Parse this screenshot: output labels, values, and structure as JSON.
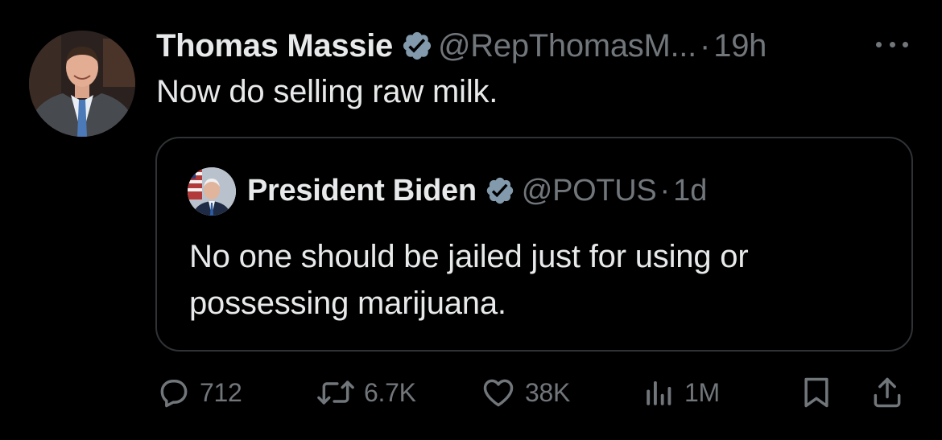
{
  "tweet": {
    "author_name": "Thomas Massie",
    "author_handle": "@RepThomasM...",
    "separator": "·",
    "time": "19h",
    "text": "Now do selling raw milk."
  },
  "quoted": {
    "author_name": "President Biden",
    "author_handle": "@POTUS",
    "separator": "·",
    "time": "1d",
    "text": "No one should be jailed just for using or possessing marijuana."
  },
  "actions": {
    "replies": "712",
    "reposts": "6.7K",
    "likes": "38K",
    "views": "1M"
  },
  "icons": {
    "more": "more-options-icon",
    "verified": "verified-badge-icon",
    "reply": "reply-icon",
    "repost": "repost-icon",
    "like": "heart-icon",
    "views": "views-chart-icon",
    "bookmark": "bookmark-icon",
    "share": "share-icon"
  },
  "colors": {
    "background": "#000000",
    "text_primary": "#e7e9ea",
    "text_secondary": "#71767b",
    "border": "#2f3336",
    "verified_gray": "#829aab"
  }
}
